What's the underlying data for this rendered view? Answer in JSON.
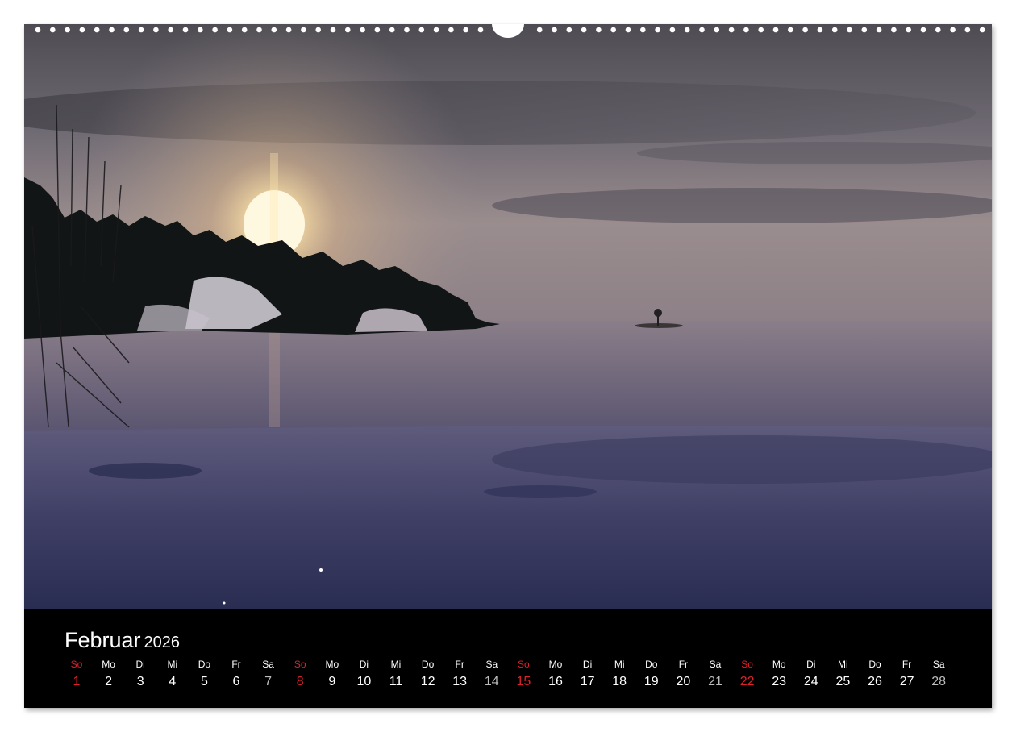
{
  "calendar": {
    "month": "Februar",
    "year": "2026",
    "weekday_color_sunday": "#e0202a",
    "days": [
      {
        "dow": "So",
        "day": "1"
      },
      {
        "dow": "Mo",
        "day": "2"
      },
      {
        "dow": "Di",
        "day": "3"
      },
      {
        "dow": "Mi",
        "day": "4"
      },
      {
        "dow": "Do",
        "day": "5"
      },
      {
        "dow": "Fr",
        "day": "6"
      },
      {
        "dow": "Sa",
        "day": "7"
      },
      {
        "dow": "So",
        "day": "8"
      },
      {
        "dow": "Mo",
        "day": "9"
      },
      {
        "dow": "Di",
        "day": "10"
      },
      {
        "dow": "Mi",
        "day": "11"
      },
      {
        "dow": "Do",
        "day": "12"
      },
      {
        "dow": "Fr",
        "day": "13"
      },
      {
        "dow": "Sa",
        "day": "14"
      },
      {
        "dow": "So",
        "day": "15"
      },
      {
        "dow": "Mo",
        "day": "16"
      },
      {
        "dow": "Di",
        "day": "17"
      },
      {
        "dow": "Mi",
        "day": "18"
      },
      {
        "dow": "Do",
        "day": "19"
      },
      {
        "dow": "Fr",
        "day": "20"
      },
      {
        "dow": "Sa",
        "day": "21"
      },
      {
        "dow": "So",
        "day": "22"
      },
      {
        "dow": "Mo",
        "day": "23"
      },
      {
        "dow": "Di",
        "day": "24"
      },
      {
        "dow": "Mi",
        "day": "25"
      },
      {
        "dow": "Do",
        "day": "26"
      },
      {
        "dow": "Fr",
        "day": "27"
      },
      {
        "dow": "Sa",
        "day": "28"
      }
    ]
  }
}
